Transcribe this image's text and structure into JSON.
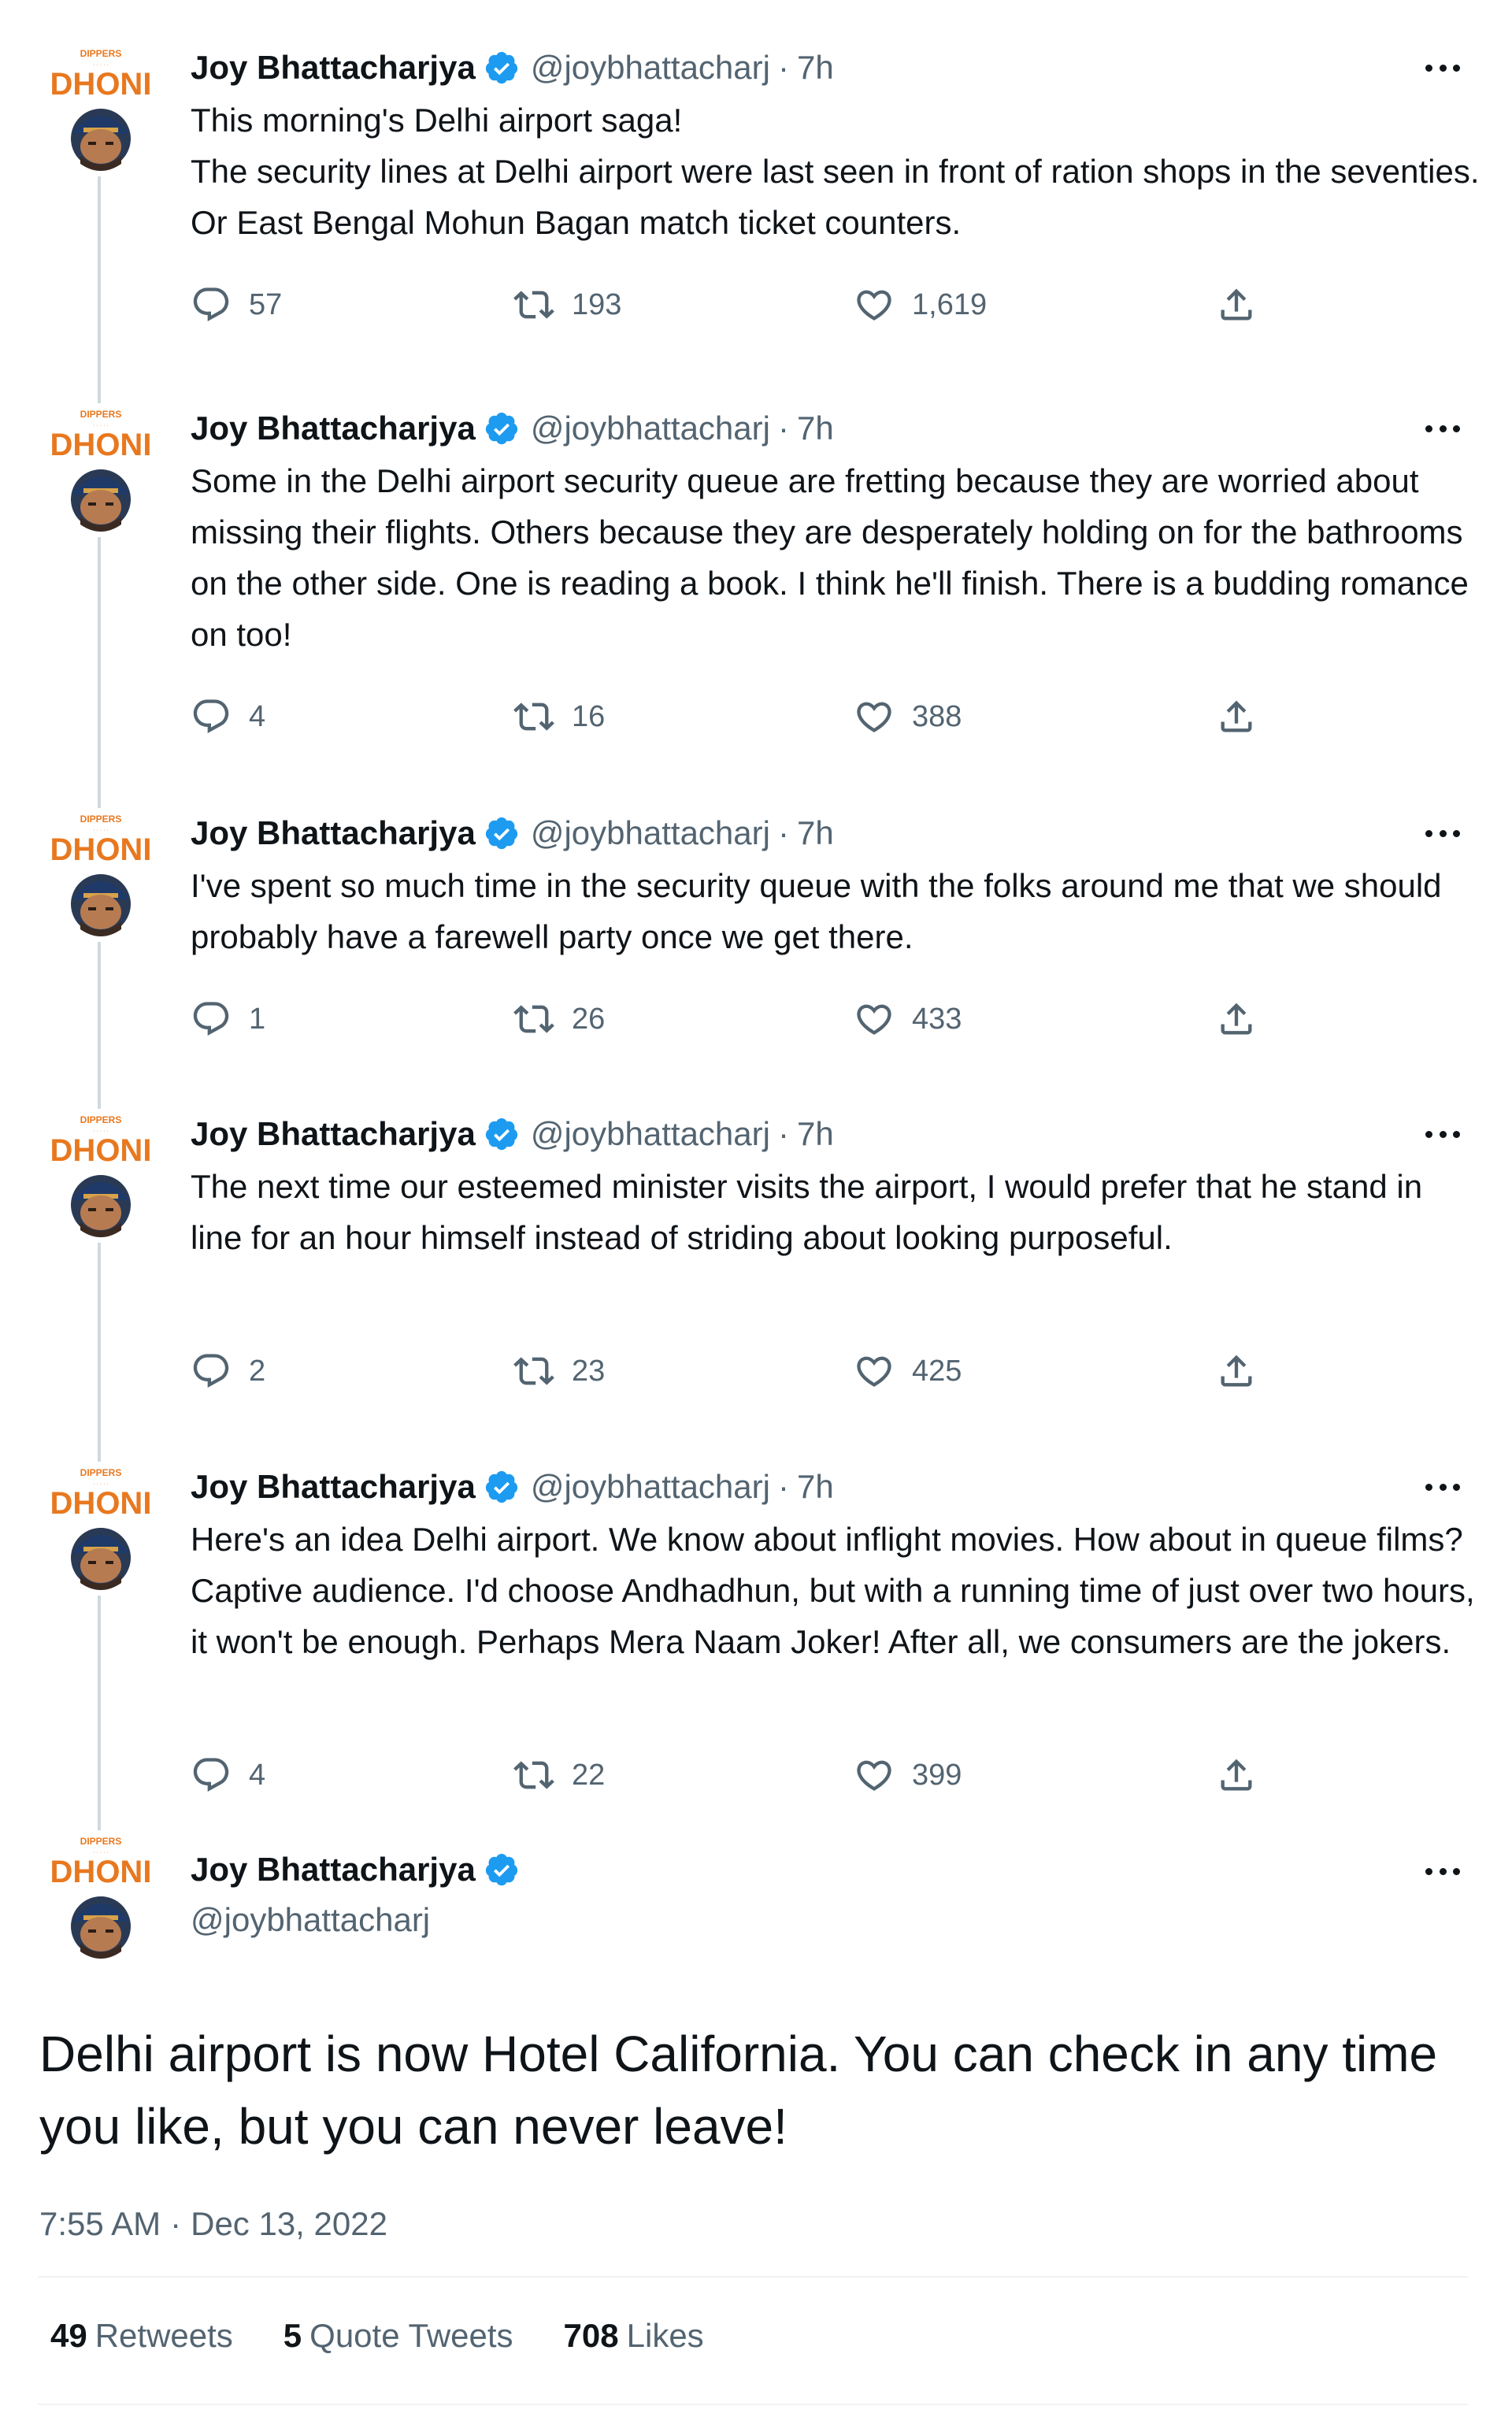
{
  "colors": {
    "text": "#0f1419",
    "secondary": "#536471",
    "verified": "#1d9bf0",
    "rail": "#cfd9de",
    "avatar_wordmark": "#e8781f",
    "avatar_cap": "#1f3a68"
  },
  "avatar": {
    "wordmark": "DHONI",
    "top_text": "DIPPERS"
  },
  "author": {
    "name": "Joy Bhattacharjya",
    "handle": "@joybhattacharj",
    "verified_icon": "verified-badge-icon"
  },
  "tweets": [
    {
      "time": "7h",
      "text": "This morning's Delhi airport saga!\nThe security lines at Delhi airport were last seen in front of ration shops in the seventies. Or East Bengal Mohun Bagan match ticket counters.",
      "replies": "57",
      "retweets": "193",
      "likes": "1,619"
    },
    {
      "time": "7h",
      "text": "Some in the Delhi airport security queue are fretting because they are worried about missing their flights. Others because they are desperately holding on for the bathrooms on the other side. One is reading a book. I think he'll finish. There is a budding romance on too!",
      "replies": "4",
      "retweets": "16",
      "likes": "388"
    },
    {
      "time": "7h",
      "text": "I've spent so much time in the security queue with the folks around me that we should probably have a farewell party once we get there.",
      "replies": "1",
      "retweets": "26",
      "likes": "433"
    },
    {
      "time": "7h",
      "text": "The next time our esteemed minister visits the airport, I would prefer that he stand in line for an hour himself instead of striding about looking purposeful.",
      "replies": "2",
      "retweets": "23",
      "likes": "425"
    },
    {
      "time": "7h",
      "text": "Here's an idea Delhi airport. We know about inflight movies. How about in queue films? Captive audience. I'd choose Andhadhun, but with a running time of just over two hours, it won't be enough. Perhaps Mera Naam Joker! After all, we consumers are the jokers.",
      "replies": "4",
      "retweets": "22",
      "likes": "399"
    }
  ],
  "main_tweet": {
    "text": "Delhi airport is now Hotel California. You can check in any time you like, but you can never leave!",
    "time": "7:55 AM",
    "separator": "·",
    "date": "Dec 13, 2022",
    "stats": [
      {
        "count": "49",
        "label": "Retweets"
      },
      {
        "count": "5",
        "label": "Quote Tweets"
      },
      {
        "count": "708",
        "label": "Likes"
      }
    ]
  },
  "icons": {
    "reply": "reply-icon",
    "retweet": "retweet-icon",
    "like": "heart-icon",
    "share": "share-icon",
    "more": "more-icon"
  },
  "separator": "·"
}
